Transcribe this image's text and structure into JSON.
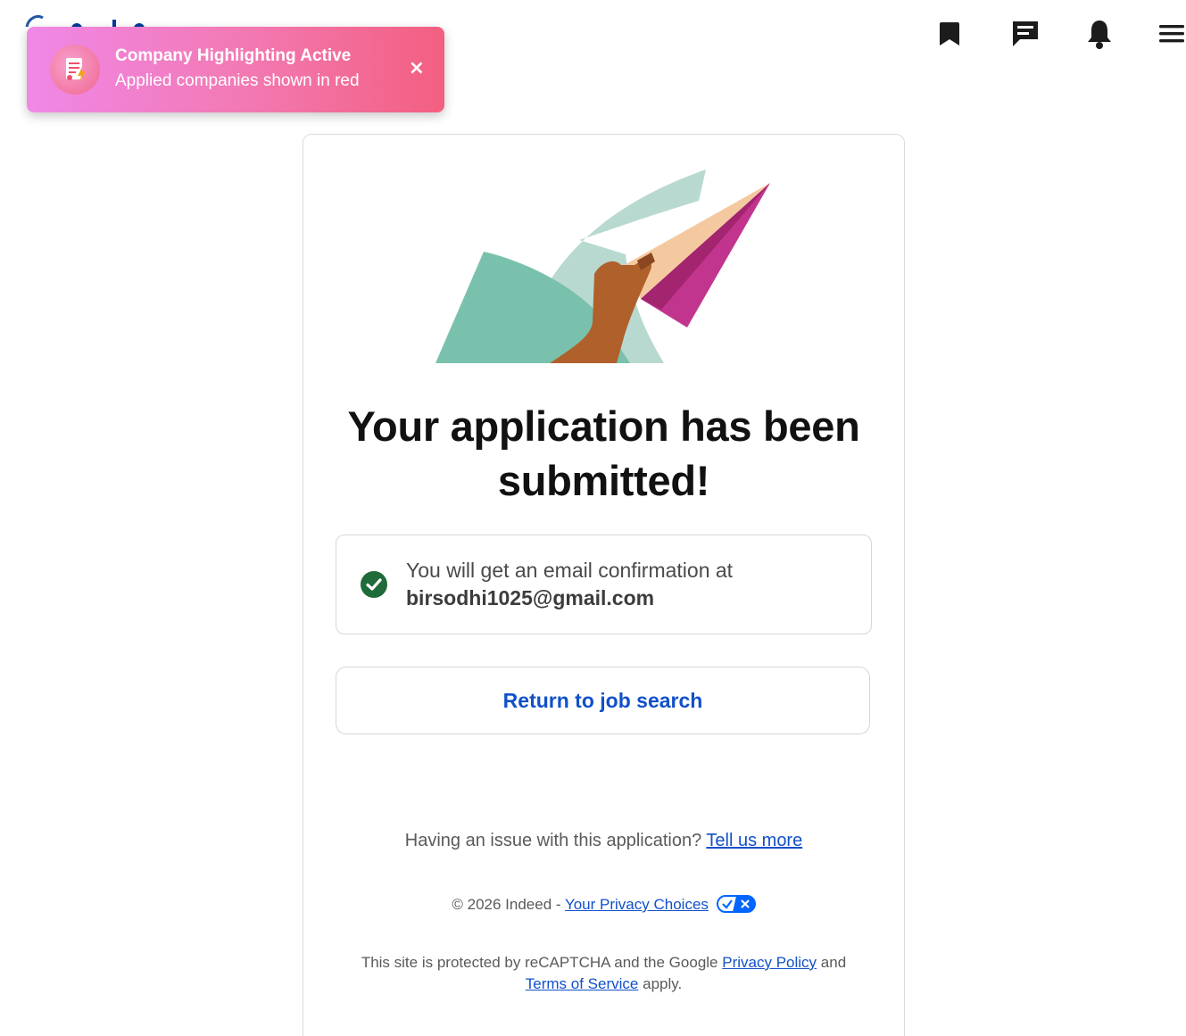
{
  "header": {
    "icons": [
      {
        "name": "bookmark-icon"
      },
      {
        "name": "messages-icon"
      },
      {
        "name": "notifications-icon"
      },
      {
        "name": "menu-icon"
      }
    ]
  },
  "toast": {
    "title": "Company Highlighting Active",
    "subtitle": "Applied companies shown in red",
    "close_label": "×"
  },
  "main": {
    "headline_line1": "Your application has been",
    "headline_line2": "submitted!",
    "confirmation_text": "You will get an email confirmation at",
    "confirmation_email": "birsodhi1025@gmail.com",
    "return_button": "Return to job search"
  },
  "footer": {
    "issue_text": "Having an issue with this application?",
    "issue_link": "Tell us more",
    "copyright": "© 2026 Indeed -",
    "privacy_choices_link": "Your Privacy Choices",
    "recaptcha_prefix": "This site is protected by reCAPTCHA and the Google",
    "privacy_policy_link": "Privacy Policy",
    "recaptcha_and": "and",
    "terms_link": "Terms of Service",
    "recaptcha_suffix": "apply."
  },
  "colors": {
    "link": "#1150c8",
    "success_check": "#1f6b3a",
    "toast_gradient_start": "#f088e8",
    "toast_gradient_end": "#f35f80"
  }
}
